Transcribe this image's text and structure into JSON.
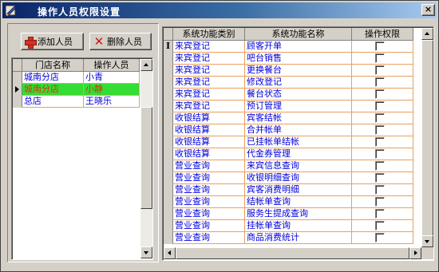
{
  "window": {
    "title": "操作人员权限设置",
    "close_glyph": "×",
    "accent_titlebar": "#0a246a"
  },
  "toolbar": {
    "add_label": "添加人员",
    "delete_label": "删除人员",
    "add_icon": "plus-icon",
    "delete_icon": "x-icon"
  },
  "staff_grid": {
    "columns": [
      "门店名称",
      "操作人员"
    ],
    "rows": [
      {
        "store": "城南分店",
        "person": "小青",
        "selected": false
      },
      {
        "store": "城南分店",
        "person": "小静",
        "selected": true
      },
      {
        "store": "总店",
        "person": "王晓乐",
        "selected": false
      }
    ],
    "selected_row_color": "#33dd33"
  },
  "perm_grid": {
    "columns": [
      "系统功能类别",
      "系统功能名称",
      "操作权限"
    ],
    "rows": [
      {
        "category": "来宾登记",
        "name": "顾客开单"
      },
      {
        "category": "来宾登记",
        "name": "吧台销售"
      },
      {
        "category": "来宾登记",
        "name": "更换餐台"
      },
      {
        "category": "来宾登记",
        "name": "修改登记"
      },
      {
        "category": "来宾登记",
        "name": "餐台状态"
      },
      {
        "category": "来宾登记",
        "name": "预订管理"
      },
      {
        "category": "收银结算",
        "name": "宾客结帐"
      },
      {
        "category": "收银结算",
        "name": "合并帐单"
      },
      {
        "category": "收银结算",
        "name": "已挂帐单结帐"
      },
      {
        "category": "收银结算",
        "name": "代金券管理"
      },
      {
        "category": "营业查询",
        "name": "来宾信息查询"
      },
      {
        "category": "营业查询",
        "name": "收银明细查询"
      },
      {
        "category": "营业查询",
        "name": "宾客消费明细"
      },
      {
        "category": "营业查询",
        "name": "结帐单查询"
      },
      {
        "category": "营业查询",
        "name": "服务生提成查询"
      },
      {
        "category": "营业查询",
        "name": "挂帐单查询"
      },
      {
        "category": "营业查询",
        "name": "商品消费统计"
      }
    ]
  }
}
